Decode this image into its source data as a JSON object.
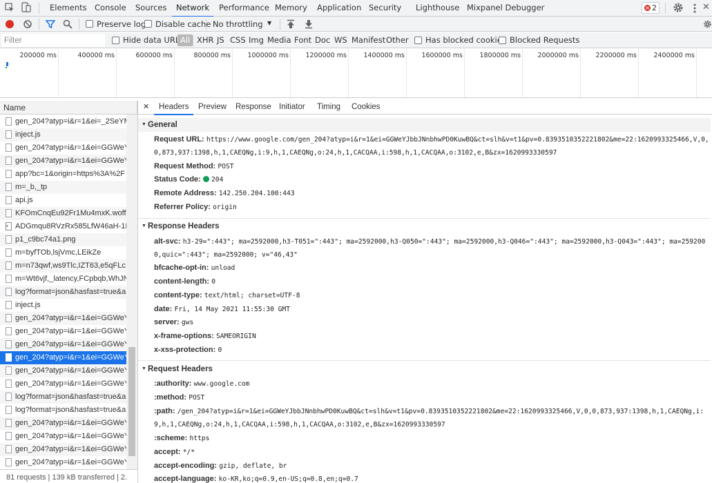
{
  "tabs": [
    "Elements",
    "Console",
    "Sources",
    "Network",
    "Performance",
    "Memory",
    "Application",
    "Security",
    "Lighthouse",
    "Mixpanel Debugger"
  ],
  "error_count": "2",
  "toolbar": {
    "preserve_log": "Preserve log",
    "disable_cache": "Disable cache",
    "throttling": "No throttling"
  },
  "filter": {
    "placeholder": "Filter",
    "hide_data_urls": "Hide data URLs",
    "types": [
      "All",
      "XHR",
      "JS",
      "CSS",
      "Img",
      "Media",
      "Font",
      "Doc",
      "WS",
      "Manifest",
      "Other"
    ],
    "has_blocked_cookies": "Has blocked cookies",
    "blocked_requests": "Blocked Requests"
  },
  "timeline": {
    "ticks": [
      "200000 ms",
      "400000 ms",
      "600000 ms",
      "800000 ms",
      "1000000 ms",
      "1200000 ms",
      "1400000 ms",
      "1600000 ms",
      "1800000 ms",
      "2000000 ms",
      "2200000 ms",
      "2400000 ms"
    ]
  },
  "list": {
    "header": "Name",
    "rows": [
      {
        "name": "gen_204?atyp=i&r=1&ei=_2SeYM",
        "icon": "doc"
      },
      {
        "name": "inject.js",
        "icon": "doc"
      },
      {
        "name": "gen_204?atyp=i&r=1&ei=GGWeY",
        "icon": "doc"
      },
      {
        "name": "gen_204?atyp=i&r=1&ei=GGWeY",
        "icon": "doc"
      },
      {
        "name": "app?bc=1&origin=https%3A%2F",
        "icon": "doc"
      },
      {
        "name": "m=_b,_tp",
        "icon": "doc"
      },
      {
        "name": "api.js",
        "icon": "doc"
      },
      {
        "name": "KFOmCnqEu92Fr1Mu4mxK.woff2",
        "icon": "doc"
      },
      {
        "name": "ADGmqu8RVzRx585LfW46aH-1R",
        "icon": "img"
      },
      {
        "name": "p1_c9bc74a1.png",
        "icon": "doc"
      },
      {
        "name": "m=byfTOb,lsjVmc,LEikZe",
        "icon": "doc"
      },
      {
        "name": "m=n73qwf,ws9Tlc,IZT63,e5qFLc,G",
        "icon": "doc"
      },
      {
        "name": "m=Wt6vjf,_latency,FCpbqb,WhJN",
        "icon": "doc"
      },
      {
        "name": "log?format=json&hasfast=true&a",
        "icon": "doc"
      },
      {
        "name": "inject.js",
        "icon": "doc"
      },
      {
        "name": "gen_204?atyp=i&r=1&ei=GGWeY",
        "icon": "doc"
      },
      {
        "name": "gen_204?atyp=i&r=1&ei=GGWeY",
        "icon": "doc"
      },
      {
        "name": "gen_204?atyp=i&r=1&ei=GGWeY",
        "icon": "doc"
      },
      {
        "name": "gen_204?atyp=i&r=1&ei=GGWeY",
        "icon": "doc",
        "selected": true
      },
      {
        "name": "gen_204?atyp=i&r=1&ei=GGWeY",
        "icon": "doc"
      },
      {
        "name": "gen_204?atyp=i&r=1&ei=GGWeY",
        "icon": "doc"
      },
      {
        "name": "log?format=json&hasfast=true&a",
        "icon": "doc"
      },
      {
        "name": "log?format=json&hasfast=true&a",
        "icon": "doc"
      },
      {
        "name": "gen_204?atyp=i&r=1&ei=GGWeY",
        "icon": "doc"
      },
      {
        "name": "gen_204?atyp=i&r=1&ei=GGWeY",
        "icon": "doc"
      },
      {
        "name": "gen_204?atyp=i&r=1&ei=GGWeY",
        "icon": "doc"
      },
      {
        "name": "gen_204?atyp=i&r=1&ei=GGWeY",
        "icon": "doc"
      }
    ]
  },
  "status": "81 requests  |  139 kB transferred  |  2.",
  "detail": {
    "tabs": [
      "Headers",
      "Preview",
      "Response",
      "Initiator",
      "Timing",
      "Cookies"
    ],
    "general": {
      "title": "General",
      "items": [
        {
          "k": "Request URL:",
          "v": "https://www.google.com/gen_204?atyp=i&r=1&ei=GGWeYJbbJNnbhwPD0KuwBQ&ct=slh&v=t1&pv=0.8393510352221802&me=22:1620993325466,V,0,0,873,937:1398,h,1,CAEQNg,i:9,h,1,CAEQNg,o:24,h,1,CACQAA,i:598,h,1,CACQAA,o:3102,e,B&zx=1620993330597"
        },
        {
          "k": "Request Method:",
          "v": "POST"
        },
        {
          "k": "Status Code:",
          "v": "204"
        },
        {
          "k": "Remote Address:",
          "v": "142.250.204.100:443"
        },
        {
          "k": "Referrer Policy:",
          "v": "origin"
        }
      ]
    },
    "response_headers": {
      "title": "Response Headers",
      "items": [
        {
          "k": "alt-svc:",
          "v": "h3-29=\":443\"; ma=2592000,h3-T051=\":443\"; ma=2592000,h3-Q050=\":443\"; ma=2592000,h3-Q046=\":443\"; ma=2592000,h3-Q043=\":443\"; ma=2592000,quic=\":443\"; ma=2592000; v=\"46,43\""
        },
        {
          "k": "bfcache-opt-in:",
          "v": "unload"
        },
        {
          "k": "content-length:",
          "v": "0"
        },
        {
          "k": "content-type:",
          "v": "text/html; charset=UTF-8"
        },
        {
          "k": "date:",
          "v": "Fri, 14 May 2021 11:55:30 GMT"
        },
        {
          "k": "server:",
          "v": "gws"
        },
        {
          "k": "x-frame-options:",
          "v": "SAMEORIGIN"
        },
        {
          "k": "x-xss-protection:",
          "v": "0"
        }
      ]
    },
    "request_headers": {
      "title": "Request Headers",
      "items": [
        {
          "k": ":authority:",
          "v": "www.google.com"
        },
        {
          "k": ":method:",
          "v": "POST"
        },
        {
          "k": ":path:",
          "v": "/gen_204?atyp=i&r=1&ei=GGWeYJbbJNnbhwPD0KuwBQ&ct=slh&v=t1&pv=0.8393510352221802&me=22:1620993325466,V,0,0,873,937:1398,h,1,CAEQNg,i:9,h,1,CAEQNg,o:24,h,1,CACQAA,i:598,h,1,CACQAA,o:3102,e,B&zx=1620993330597"
        },
        {
          "k": ":scheme:",
          "v": "https"
        },
        {
          "k": "accept:",
          "v": "*/*"
        },
        {
          "k": "accept-encoding:",
          "v": "gzip, deflate, br"
        },
        {
          "k": "accept-language:",
          "v": "ko-KR,ko;q=0.9,en-US;q=0.8,en;q=0.7"
        }
      ]
    }
  },
  "colors": {
    "accent": "#1a73e8",
    "record": "#d93025",
    "status_ok": "#0f9d58"
  }
}
